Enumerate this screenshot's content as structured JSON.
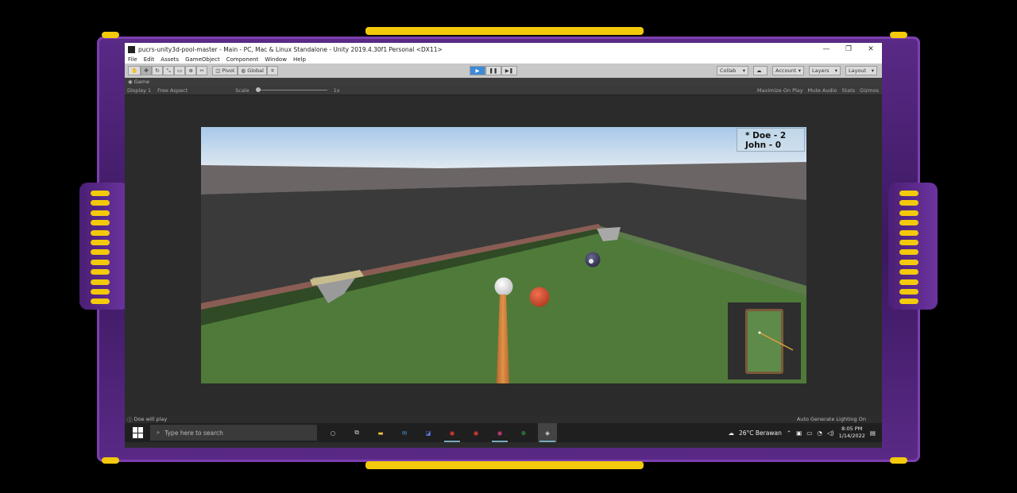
{
  "window": {
    "title": "pucrs-unity3d-pool-master - Main - PC, Mac & Linux Standalone - Unity 2019.4.30f1 Personal <DX11>",
    "controls": [
      "—",
      "❐",
      "✕"
    ]
  },
  "menu": [
    "File",
    "Edit",
    "Assets",
    "GameObject",
    "Component",
    "Window",
    "Help"
  ],
  "toolbar": {
    "pivot": "Pivot",
    "global": "Global",
    "collab": "Collab",
    "account": "Account",
    "layers": "Layers",
    "layout": "Layout"
  },
  "game_tab": "Game",
  "game_bar": {
    "display": "Display 1",
    "aspect": "Free Aspect",
    "scale_label": "Scale",
    "scale_value": "1x",
    "options": [
      "Maximize On Play",
      "Mute Audio",
      "Stats",
      "Gizmos"
    ]
  },
  "scoreboard": [
    "* Doe - 2",
    "John - 0"
  ],
  "status": {
    "message": "Doe will play",
    "right": "Auto Generate Lighting On"
  },
  "taskbar": {
    "search_placeholder": "Type here to search",
    "weather": "26°C  Berawan",
    "time": "8:05 PM",
    "date": "1/14/2022"
  },
  "colors": {
    "frame_purple": "#5a2a86",
    "frame_gold": "#f3c90b",
    "play_blue": "#3d8ad8",
    "felt_green": "#4f7a3a"
  }
}
